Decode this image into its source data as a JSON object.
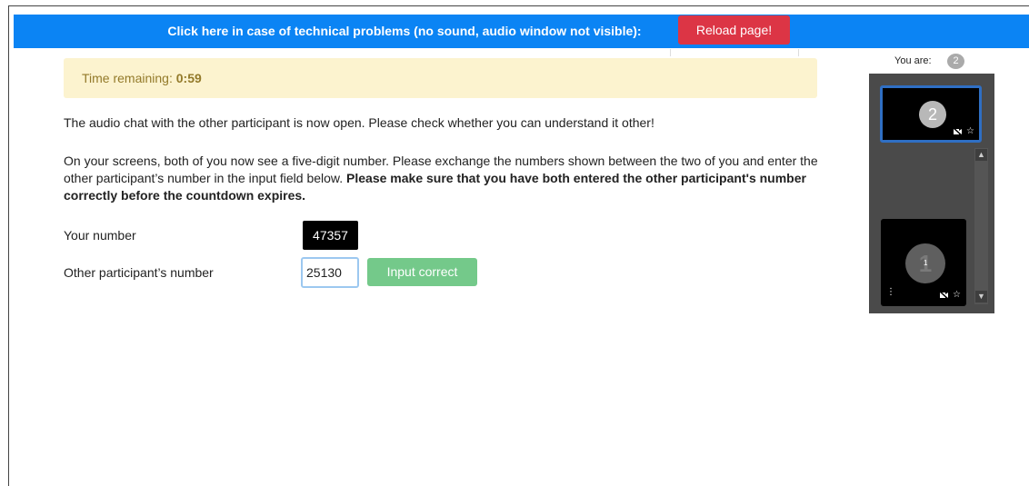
{
  "header": {
    "tech_problems_text": "Click here in case of technical problems (no sound, audio window not visible):",
    "reload_label": "Reload page!"
  },
  "timer": {
    "label": "Time remaining: ",
    "value": "0:59"
  },
  "instructions": {
    "p1": "The audio chat with the other participant is now open. Please check whether you can understand it other!",
    "p2_normal": "On your screens, both of you now see a five-digit number. Please exchange the numbers shown between the two of you and enter the other participant’s number in the input field below. ",
    "p2_bold": "Please make sure that you have both entered the other participant's number correctly before the countdown expires."
  },
  "form": {
    "your_number_label": "Your number",
    "your_number_value": "47357",
    "other_number_label": "Other participant’s number",
    "other_number_value": "25130",
    "confirm_label": "Input correct"
  },
  "video_panel": {
    "you_are_label": "You are:",
    "you_are_id": "2",
    "self_tile_id": "2",
    "other_tile_id": "1",
    "other_tile_sub": "1",
    "icons": [
      "camera-off-icon",
      "star-icon",
      "menu-dots-icon",
      "scroll-up-icon",
      "scroll-down-icon"
    ]
  },
  "colors": {
    "topbar": "#0b84f4",
    "reload": "#dc3545",
    "confirm": "#74c98a",
    "timer_bg": "#fcf3cf",
    "timer_text": "#937a2a",
    "self_tile_border": "#2f6fc4"
  }
}
